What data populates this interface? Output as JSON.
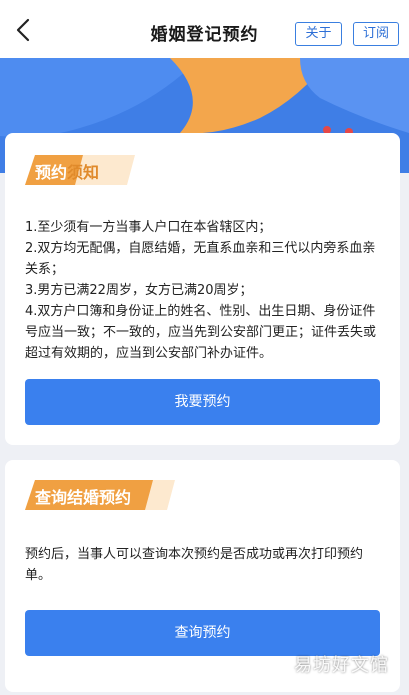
{
  "nav": {
    "title": "婚姻登记预约",
    "about_label": "关于",
    "subscribe_label": "订阅"
  },
  "card1": {
    "tag_part1": "预约",
    "tag_part2": "须知",
    "notice_items": [
      "1.至少须有一方当事人户口在本省辖区内；",
      "2.双方均无配偶，自愿结婚，无直系血亲和三代以内旁系血亲关系；",
      "3.男方已满22周岁，女方已满20周岁；",
      "4.双方户口簿和身份证上的姓名、性别、出生日期、身份证件号应当一致；不一致的，应当先到公安部门更正；证件丢失或超过有效期的，应当到公安部门补办证件。"
    ],
    "button_label": "我要预约"
  },
  "card2": {
    "tag": "查询结婚预约",
    "description": "预约后，当事人可以查询本次预约是否成功或再次打印预约单。",
    "button_label": "查询预约"
  },
  "watermark": "易坊好文馆",
  "colors": {
    "primary": "#3a80ee",
    "tag_orange": "#f0a042",
    "banner": "#3f7ee6"
  }
}
